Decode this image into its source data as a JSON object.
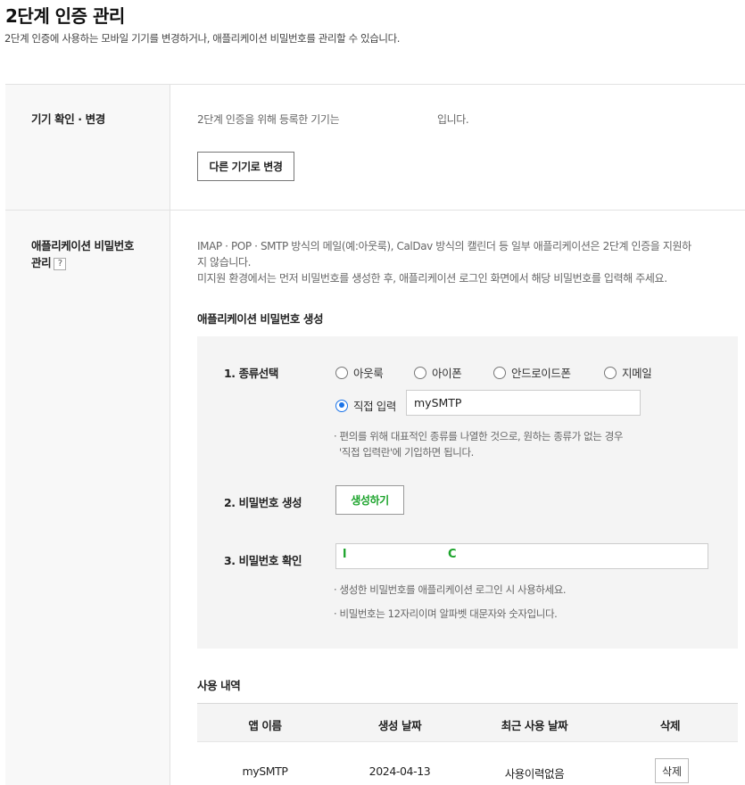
{
  "page": {
    "title": "2단계 인증 관리",
    "description": "2단계 인증에 사용하는 모바일 기기를 변경하거나, 애플리케이션 비밀번호를 관리할 수 있습니다."
  },
  "device_section": {
    "label": "기기 확인 · 변경",
    "status_prefix": "2단계 인증을 위해 등록한 기기는",
    "status_suffix": "입니다.",
    "change_button": "다른 기기로 변경"
  },
  "app_password_section": {
    "label_line1": "애플리케이션 비밀번호",
    "label_line2": "관리",
    "help_icon": "?",
    "desc_line1": "IMAP · POP · SMTP 방식의 메일(예:아웃룩), CalDav 방식의 캘린더 등 일부 애플리케이션은 2단계 인증을 지원하",
    "desc_line2": "지 않습니다.",
    "desc_line3": "미지원 환경에서는 먼저 비밀번호를 생성한 후, 애플리케이션 로그인 화면에서 해당 비밀번호를 입력해 주세요.",
    "generate_title": "애플리케이션 비밀번호 생성",
    "step1": {
      "label": "1. 종류선택",
      "options": [
        "아웃룩",
        "아이폰",
        "안드로이드폰",
        "지메일"
      ],
      "custom_label": "직접 입력",
      "custom_value": "mySMTP",
      "selected": "직접 입력",
      "note_line1": "· 편의를 위해 대표적인 종류를 나열한 것으로, 원하는 종류가 없는 경우",
      "note_line2": "'직접 입력란'에 기입하면 됩니다."
    },
    "step2": {
      "label": "2. 비밀번호 생성",
      "button": "생성하기"
    },
    "step3": {
      "label": "3. 비밀번호 확인",
      "password_first": "l",
      "password_mid": "C",
      "note1": "· 생성한 비밀번호를 애플리케이션 로그인 시 사용하세요.",
      "note2": "· 비밀번호는 12자리이며 알파벳 대문자와 숫자입니다."
    },
    "history": {
      "title": "사용 내역",
      "columns": [
        "앱 이름",
        "생성 날짜",
        "최근 사용 날짜",
        "삭제"
      ],
      "rows": [
        {
          "app": "mySMTP",
          "created": "2024-04-13",
          "last_used": "사용이력없음",
          "delete": "삭제"
        }
      ]
    }
  },
  "colors": {
    "accent_green": "#1aa32a",
    "radio_blue": "#1a73e8",
    "panel_bg": "#f4f4f4",
    "left_col_bg": "#f8f8f8"
  }
}
